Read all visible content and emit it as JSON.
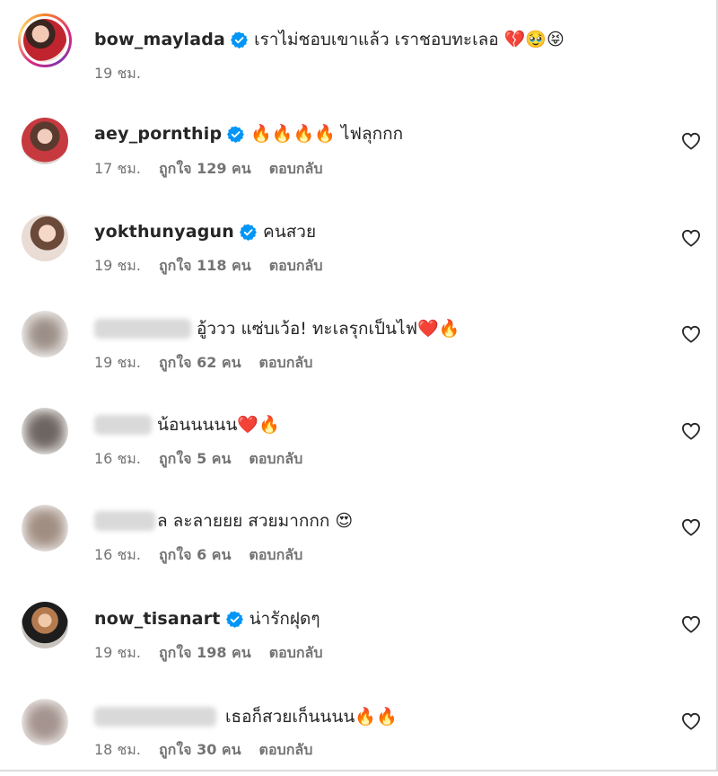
{
  "comments": [
    {
      "username": "bow_maylada",
      "verified": true,
      "text": "เราไม่ชอบเขาแล้ว เราชอบทะเลอ 💔🥹😝",
      "time": "19 ชม.",
      "likes": "",
      "reply": "",
      "has_heart": false
    },
    {
      "username": "aey_pornthip",
      "verified": true,
      "text": "🔥🔥🔥🔥 ไฟลุกกก",
      "time": "17 ชม.",
      "likes": "ถูกใจ 129 คน",
      "reply": "ตอบกลับ",
      "has_heart": true
    },
    {
      "username": "yokthunyagun",
      "verified": true,
      "text": "คนสวย",
      "time": "19 ชม.",
      "likes": "ถูกใจ 118 คน",
      "reply": "ตอบกลับ",
      "has_heart": true
    },
    {
      "username": "",
      "verified": false,
      "text": "อู้ววว แซ่บเว้อ! ทะเลรุกเป็นไฟ❤️🔥",
      "time": "19 ชม.",
      "likes": "ถูกใจ 62 คน",
      "reply": "ตอบกลับ",
      "has_heart": true
    },
    {
      "username": "",
      "verified": false,
      "text": "น้อนนนนน❤️🔥",
      "time": "16 ชม.",
      "likes": "ถูกใจ 5 คน",
      "reply": "ตอบกลับ",
      "has_heart": true
    },
    {
      "username": "",
      "verified": false,
      "text": "ล ละลายยย สวยมากกก 😍",
      "time": "16 ชม.",
      "likes": "ถูกใจ 6 คน",
      "reply": "ตอบกลับ",
      "has_heart": true
    },
    {
      "username": "now_tisanart",
      "verified": true,
      "text": "น่ารักฝุดๆ",
      "time": "19 ชม.",
      "likes": "ถูกใจ 198 คน",
      "reply": "ตอบกลับ",
      "has_heart": true
    },
    {
      "username": "",
      "verified": false,
      "text": "เธอก็สวยเก็นนนน🔥🔥",
      "time": "18 ชม.",
      "likes": "ถูกใจ 30 คน",
      "reply": "ตอบกลับ",
      "has_heart": true
    }
  ],
  "icons": {
    "verified": "verified-badge-icon",
    "like": "heart-outline-icon"
  },
  "colors": {
    "verified_blue": "#0095f6",
    "text_primary": "#262626",
    "text_secondary": "#737373"
  }
}
